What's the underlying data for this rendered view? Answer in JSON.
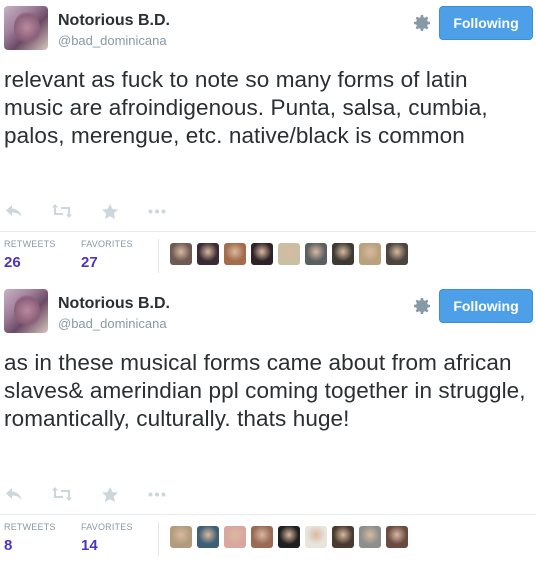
{
  "tweets": [
    {
      "name": "Notorious B.D.",
      "handle": "@bad_dominicana",
      "follow_label": "Following",
      "text": "relevant as fuck to note so many forms of latin music are afroindigenous. Punta, salsa, cumbia, palos, merengue, etc. native/black is common",
      "retweets_label": "RETWEETS",
      "retweets": "26",
      "favorites_label": "FAVORITES",
      "favorites": "27",
      "faces": [
        "#6f5a52",
        "#3b2b35",
        "#a36c4c",
        "#2d2226",
        "#c9bfa4",
        "#5a5f62",
        "#3c3a32",
        "#b7a27d",
        "#4b443f"
      ]
    },
    {
      "name": "Notorious B.D.",
      "handle": "@bad_dominicana",
      "follow_label": "Following",
      "text": "as in these musical forms came about from african slaves& amerindian ppl coming together in struggle, romantically, culturally. thats huge!",
      "retweets_label": "RETWEETS",
      "retweets": "8",
      "favorites_label": "FAVORITES",
      "favorites": "14",
      "faces": [
        "#b39c7e",
        "#3d5e75",
        "#d9a7a0",
        "#9a6a55",
        "#1f1f1f",
        "#e7e4dc",
        "#4a3a30",
        "#8d8f8a",
        "#6b4a42"
      ]
    }
  ],
  "icons": [
    "reply-icon",
    "retweet-icon",
    "favorite-star-icon",
    "more-dots-icon",
    "gear-icon"
  ],
  "colors": {
    "follow_button": "#4da0e8",
    "stat_value": "#4d34c0",
    "muted": "#8899a6"
  }
}
